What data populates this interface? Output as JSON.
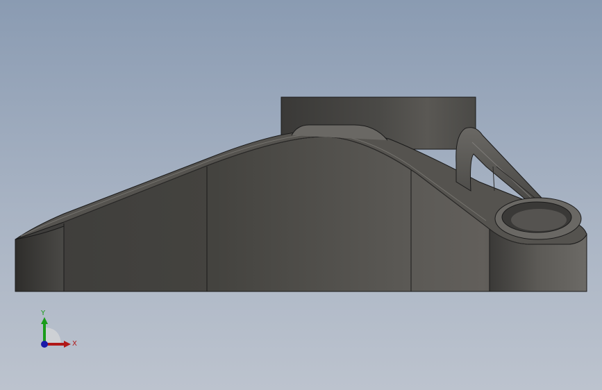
{
  "viewport": {
    "background_top": "#8a9bb2",
    "background_bottom": "#bcc3ce",
    "model_color": "#4b4a47"
  },
  "triad": {
    "x_label": "X",
    "y_label": "Y",
    "x_color": "#b01818",
    "y_color": "#1a9c1a",
    "z_color": "#1a1aa8"
  }
}
